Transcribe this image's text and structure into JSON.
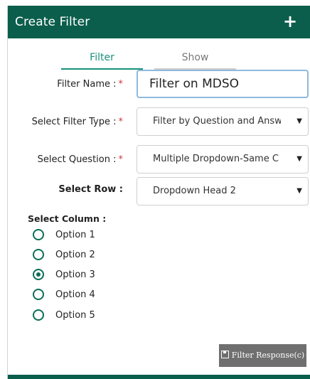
{
  "header": {
    "title": "Create Filter",
    "add_icon": "plus-icon",
    "color": "#0b5e4c"
  },
  "tabs": [
    {
      "label": "Filter",
      "active": true
    },
    {
      "label": "Show",
      "active": false
    }
  ],
  "form": {
    "filter_name": {
      "label": "Filter Name :",
      "required": "*",
      "value": "Filter on MDSO"
    },
    "filter_type": {
      "label": "Select Filter Type :",
      "required": "*",
      "value": "Filter by Question and Answ"
    },
    "question": {
      "label": "Select Question :",
      "required": "*",
      "value": "Multiple Dropdown-Same C"
    },
    "row": {
      "label": "Select Row :",
      "value": "Dropdown Head 2"
    },
    "column": {
      "label": "Select Column :",
      "options": [
        {
          "label": "Option 1",
          "checked": false
        },
        {
          "label": "Option 2",
          "checked": false
        },
        {
          "label": "Option 3",
          "checked": true
        },
        {
          "label": "Option 4",
          "checked": false
        },
        {
          "label": "Option 5",
          "checked": false
        }
      ]
    }
  },
  "actions": {
    "filter_response_label": "Filter Response(c)",
    "save_icon": "save-icon"
  },
  "colors": {
    "accent": "#17917a",
    "required": "#d23b3b",
    "button": "#6f6f6f"
  }
}
